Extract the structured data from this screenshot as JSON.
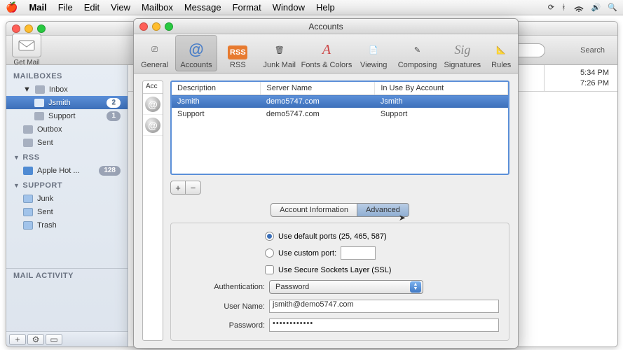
{
  "menubar": {
    "app": "Mail",
    "items": [
      "File",
      "Edit",
      "View",
      "Mailbox",
      "Message",
      "Format",
      "Window",
      "Help"
    ]
  },
  "mailWindow": {
    "getMail": "Get Mail",
    "searchPlaceholder": "Search",
    "sidebar": {
      "mailboxes": "MAILBOXES",
      "inbox": "Inbox",
      "jsmith": "Jsmith",
      "jsmithBadge": "2",
      "support": "Support",
      "supportBadge": "1",
      "outbox": "Outbox",
      "sent": "Sent",
      "rss": "RSS",
      "appleHot": "Apple Hot ...",
      "appleHotBadge": "128",
      "supportSection": "SUPPORT",
      "junk": "Junk",
      "sent2": "Sent",
      "trash": "Trash",
      "mailActivity": "MAIL ACTIVITY"
    },
    "times": {
      "t1": "5:34 PM",
      "t2": "7:26 PM"
    }
  },
  "prefs": {
    "title": "Accounts",
    "toolbar": {
      "general": "General",
      "accounts": "Accounts",
      "rss": "RSS",
      "junk": "Junk Mail",
      "fonts": "Fonts & Colors",
      "viewing": "Viewing",
      "composing": "Composing",
      "signatures": "Signatures",
      "rules": "Rules"
    },
    "acctListHeader": "Acc",
    "serverTable": {
      "col1": "Description",
      "col2": "Server Name",
      "col3": "In Use By Account",
      "rows": [
        {
          "desc": "Jsmith",
          "server": "demo5747.com",
          "account": "Jsmith"
        },
        {
          "desc": "Support",
          "server": "demo5747.com",
          "account": "Support"
        }
      ]
    },
    "tabs": {
      "info": "Account Information",
      "advanced": "Advanced"
    },
    "form": {
      "defaultPorts": "Use default ports (25, 465, 587)",
      "customPort": "Use custom port:",
      "ssl": "Use Secure Sockets Layer (SSL)",
      "authLabel": "Authentication:",
      "authValue": "Password",
      "userLabel": "User Name:",
      "userValue": "jsmith@demo5747.com",
      "passLabel": "Password:",
      "passValue": "••••••••••••"
    }
  }
}
